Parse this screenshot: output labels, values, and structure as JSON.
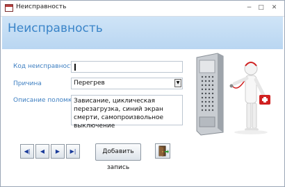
{
  "window": {
    "title": "Неисправность",
    "controls": {
      "minimize": "−",
      "maximize": "□",
      "close": "✕"
    }
  },
  "header": {
    "title": "Неисправность"
  },
  "form": {
    "code_label": "Код неисправности",
    "code_value": "",
    "reason_label": "Причина",
    "reason_value": "Перегрев",
    "description_label": "Описание поломки",
    "description_value": "Зависание, циклическая перезагрузка, синий экран смерти, самопроизвольное выключение"
  },
  "nav": {
    "first": "◀|",
    "prev": "◀",
    "next": "▶",
    "last": "▶|"
  },
  "buttons": {
    "add_record": "Добавить запись"
  },
  "illustration": {
    "description": ""
  },
  "colors": {
    "header_band": "#c6def4",
    "label_text": "#3e7fc1",
    "title_text": "#3a84c8",
    "nav_arrow": "#1a3b9a"
  }
}
